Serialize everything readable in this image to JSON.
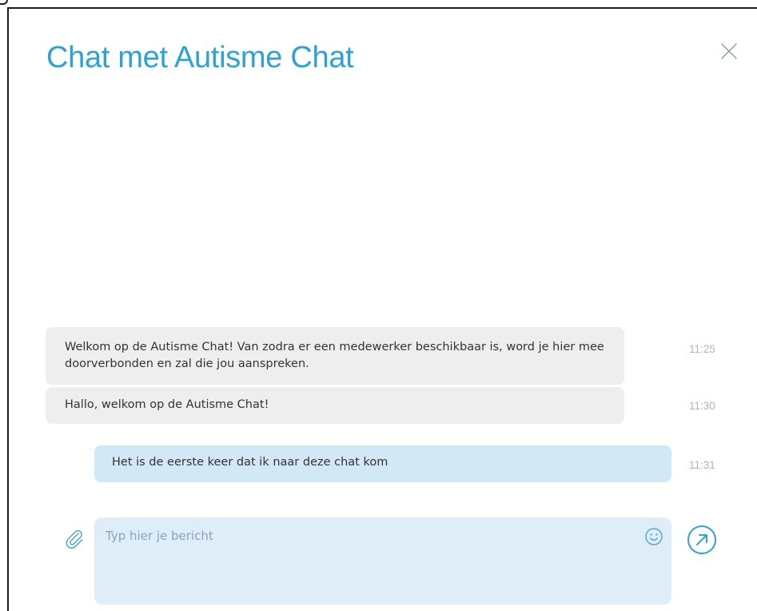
{
  "header": {
    "title": "Chat met Autisme Chat"
  },
  "messages": [
    {
      "direction": "incoming",
      "text": "Welkom op de Autisme Chat! Van zodra er een medewerker beschikbaar is, word je hier mee doorverbonden en zal die jou aanspreken.",
      "time": "11:25"
    },
    {
      "direction": "incoming",
      "text": "Hallo, welkom op de Autisme Chat!",
      "time": "11:30"
    },
    {
      "direction": "outgoing",
      "text": "Het is de eerste keer dat ik naar deze chat kom",
      "time": "11:31"
    }
  ],
  "composer": {
    "value": "",
    "placeholder": "Typ hier je bericht"
  },
  "icons": {
    "close": "close-icon",
    "attach": "paperclip-icon",
    "emoji": "smiley-icon",
    "send": "send-arrow-icon"
  },
  "colors": {
    "accent": "#2ba3d6",
    "incoming_bubble": "#eeeeee",
    "outgoing_bubble": "#d3e8f5",
    "composer_bg": "#deedf7",
    "timestamp": "#a9b6be"
  }
}
